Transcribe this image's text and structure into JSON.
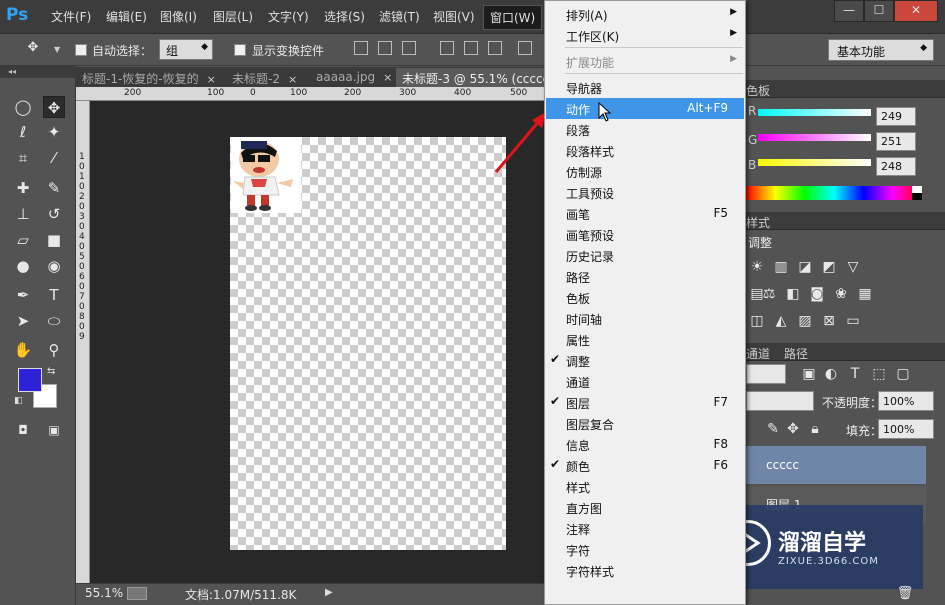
{
  "app": {
    "logo": "Ps"
  },
  "menubar": {
    "items": [
      "文件(F)",
      "编辑(E)",
      "图像(I)",
      "图层(L)",
      "文字(Y)",
      "选择(S)",
      "滤镜(T)",
      "视图(V)",
      "窗口(W)"
    ],
    "window_controls": {
      "minimize": "—",
      "maximize": "☐",
      "close": "✕"
    }
  },
  "options": {
    "auto_select_label": "自动选择：",
    "auto_select_value": "组",
    "show_transform_label": "显示变换控件",
    "workspace_value": "基本功能"
  },
  "tabs": [
    {
      "label": "标题-1-恢复的-恢复的",
      "close": "×"
    },
    {
      "label": "未标题-2",
      "close": "×"
    },
    {
      "label": "aaaaa.jpg",
      "close": "×"
    },
    {
      "label": "未标题-3 @ 55.1% (ccccc,",
      "close": ""
    }
  ],
  "ruler_top": [
    "200",
    "100",
    "0",
    "100",
    "200",
    "300",
    "400",
    "500"
  ],
  "ruler_left": [
    "1",
    "0",
    "1",
    "0",
    "2",
    "0",
    "3",
    "0",
    "4",
    "0",
    "5",
    "0",
    "6",
    "0",
    "7",
    "0",
    "8",
    "0",
    "9"
  ],
  "status": {
    "zoom": "55.1%",
    "doc_label": "文档:1.07M/511.8K"
  },
  "window_menu": {
    "items": [
      {
        "label": "排列(A)",
        "submenu": true
      },
      {
        "label": "工作区(K)",
        "submenu": true
      },
      {
        "separator": true
      },
      {
        "label": "扩展功能",
        "submenu": true,
        "disabled": true
      },
      {
        "separator": true
      },
      {
        "label": "导航器"
      },
      {
        "label": "动作",
        "shortcut": "Alt+F9",
        "highlighted": true
      },
      {
        "label": "段落"
      },
      {
        "label": "段落样式"
      },
      {
        "label": "仿制源"
      },
      {
        "label": "工具预设"
      },
      {
        "label": "画笔",
        "shortcut": "F5"
      },
      {
        "label": "画笔预设"
      },
      {
        "label": "历史记录"
      },
      {
        "label": "路径"
      },
      {
        "label": "色板"
      },
      {
        "label": "时间轴"
      },
      {
        "label": "属性"
      },
      {
        "label": "调整",
        "checked": true
      },
      {
        "label": "通道"
      },
      {
        "label": "图层",
        "shortcut": "F7",
        "checked": true
      },
      {
        "label": "图层复合"
      },
      {
        "label": "信息",
        "shortcut": "F8"
      },
      {
        "label": "颜色",
        "shortcut": "F6",
        "checked": true
      },
      {
        "label": "样式"
      },
      {
        "label": "直方图"
      },
      {
        "label": "注释"
      },
      {
        "label": "字符"
      },
      {
        "label": "字符样式"
      }
    ]
  },
  "color_panel": {
    "tab": "色板",
    "r_label": "R",
    "g_label": "G",
    "b_label": "B",
    "r": "249",
    "g": "251",
    "b": "248"
  },
  "styles_panel": {
    "tab": "样式",
    "adjust_label": "调整"
  },
  "layers_panel": {
    "tabs": [
      "通道",
      "路径"
    ],
    "opacity_label": "不透明度：",
    "opacity_value": "100%",
    "fill_label": "填充：",
    "fill_value": "100%",
    "layers": [
      "ccccc",
      "图层 1"
    ]
  },
  "watermark": {
    "title": "溜溜自学",
    "subtitle": "ZIXUE.3D66.COM"
  },
  "colors": {
    "foreground": "#2c22d6",
    "background": "#ffffff",
    "highlight": "#3f96e8"
  }
}
